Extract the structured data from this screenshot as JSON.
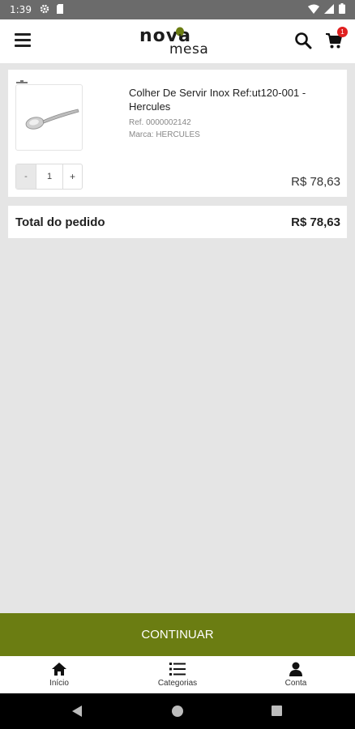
{
  "status_bar": {
    "time": "1:39",
    "icons": [
      "settings-icon",
      "sd-card-icon",
      "wifi-icon",
      "signal-icon",
      "battery-icon"
    ]
  },
  "header": {
    "logo_word1": "nova",
    "logo_word2": "mesa",
    "cart_count": "1",
    "icons": [
      "menu-icon",
      "search-icon",
      "cart-icon"
    ]
  },
  "cart": {
    "items": [
      {
        "name": "Colher De Servir Inox Ref:ut120-001 - Hercules",
        "ref": "Ref. 0000002142",
        "brand": "Marca: HERCULES",
        "quantity": "1",
        "minus_label": "-",
        "plus_label": "+",
        "price": "R$ 78,63"
      }
    ],
    "total_label": "Total do pedido",
    "total_value": "R$ 78,63"
  },
  "continue_label": "CONTINUAR",
  "bottom_nav": [
    {
      "label": "Início",
      "icon": "home-icon"
    },
    {
      "label": "Categorias",
      "icon": "list-icon"
    },
    {
      "label": "Conta",
      "icon": "user-icon"
    }
  ],
  "colors": {
    "accent": "#6b7d12",
    "badge": "#e02020",
    "background": "#e5e5e5"
  }
}
